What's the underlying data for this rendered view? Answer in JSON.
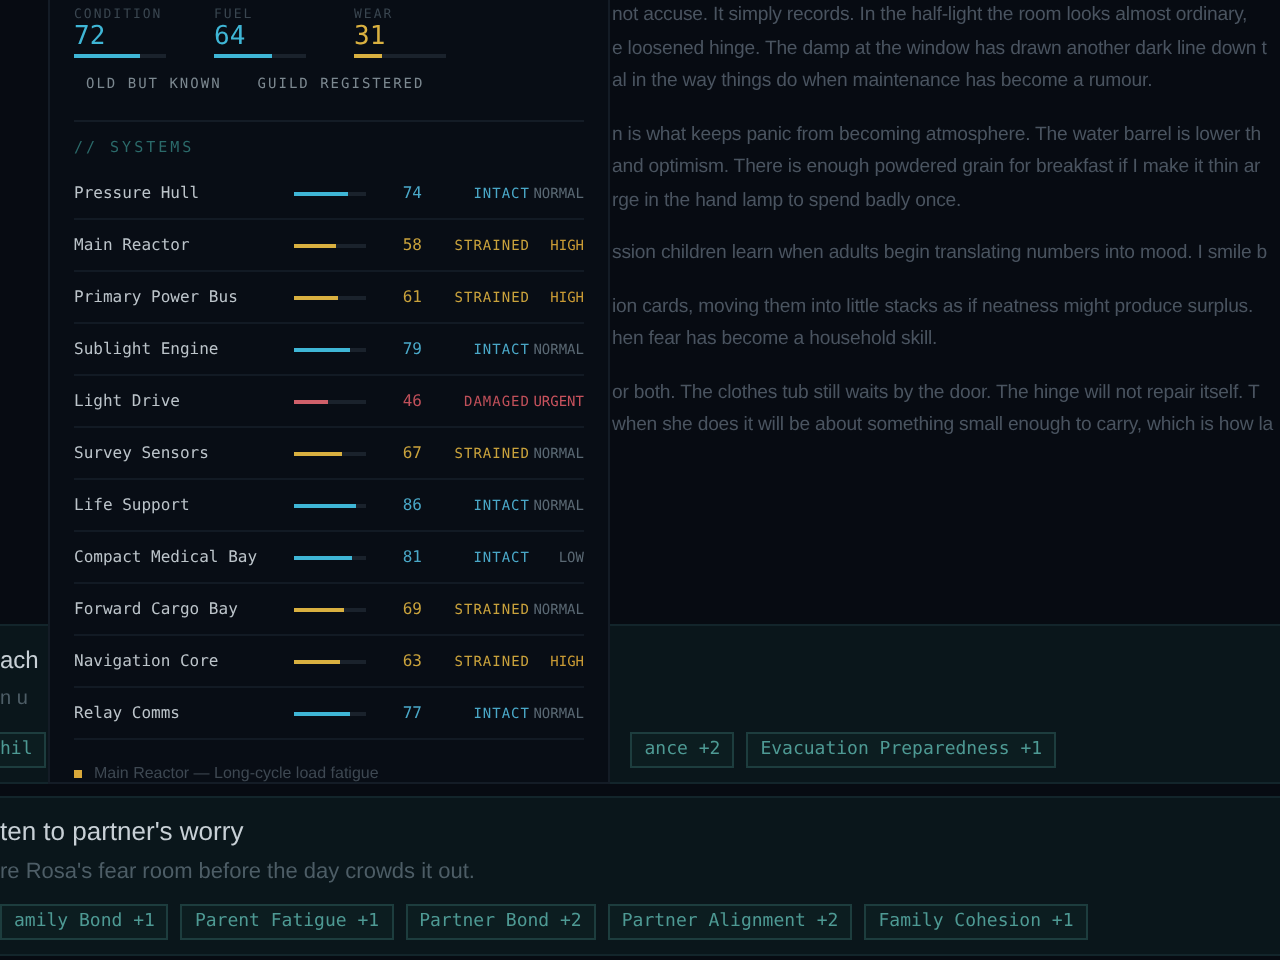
{
  "journal": {
    "paragraphs": [
      {
        "lines": [
          "not accuse. It simply records. In the half-light the room looks almost ordinary,",
          "e loosened hinge. The damp at the window has drawn another dark line down t",
          "al in the way things do when maintenance has become a rumour."
        ]
      },
      {
        "lines": [
          "n is what keeps panic from becoming atmosphere. The water barrel is lower th",
          "and optimism. There is enough powdered grain for breakfast if I make it thin ar",
          "rge in the hand lamp to spend badly once."
        ]
      },
      {
        "lines": [
          "ssion children learn when adults begin translating numbers into mood. I smile b"
        ]
      },
      {
        "lines": [
          "ion cards, moving them into little stacks as if neatness might produce surplus.",
          "hen fear has become a household skill."
        ]
      },
      {
        "lines": [
          "or both. The clothes tub still waits by the door. The hinge will not repair itself. T",
          "when she does it will be about something small enough to carry, which is how la"
        ]
      }
    ]
  },
  "actions": [
    {
      "title": "ach",
      "subtitle": "n u",
      "effects": [
        "hil",
        "ance +2",
        "Evacuation Preparedness +1"
      ]
    },
    {
      "title": "ten to partner's worry",
      "subtitle": "re Rosa's fear room before the day crowds it out.",
      "effects": [
        "amily Bond +1",
        "Parent Fatigue +1",
        "Partner Bond +2",
        "Partner Alignment +2",
        "Family Cohesion +1"
      ]
    }
  ],
  "ship_panel": {
    "stats": [
      {
        "label": "CONDITION",
        "value": "72",
        "level": 0.72,
        "kind": "good"
      },
      {
        "label": "FUEL",
        "value": "64",
        "level": 0.64,
        "kind": "good"
      },
      {
        "label": "WEAR",
        "value": "31",
        "level": 0.31,
        "kind": "warn"
      }
    ],
    "tags": [
      "OLD BUT KNOWN",
      "GUILD REGISTERED"
    ],
    "section_title": "// SYSTEMS",
    "systems": [
      {
        "name": "Pressure Hull",
        "value": "74",
        "level": 0.74,
        "kind": "intact",
        "status": "INTACT",
        "priority": {
          "label": "NORMAL",
          "color": "#5a6873"
        }
      },
      {
        "name": "Main Reactor",
        "value": "58",
        "level": 0.58,
        "kind": "strained",
        "status": "STRAINED",
        "priority": {
          "label": "HIGH",
          "color": "#c99a34"
        }
      },
      {
        "name": "Primary Power Bus",
        "value": "61",
        "level": 0.61,
        "kind": "strained",
        "status": "STRAINED",
        "priority": {
          "label": "HIGH",
          "color": "#c99a34"
        }
      },
      {
        "name": "Sublight Engine",
        "value": "79",
        "level": 0.79,
        "kind": "intact",
        "status": "INTACT",
        "priority": {
          "label": "NORMAL",
          "color": "#5a6873"
        }
      },
      {
        "name": "Light Drive",
        "value": "46",
        "level": 0.46,
        "kind": "damaged",
        "status": "DAMAGED",
        "priority": {
          "label": "URGENT",
          "color": "#c8525d"
        }
      },
      {
        "name": "Survey Sensors",
        "value": "67",
        "level": 0.67,
        "kind": "strained",
        "status": "STRAINED",
        "priority": {
          "label": "NORMAL",
          "color": "#5a6873"
        }
      },
      {
        "name": "Life Support",
        "value": "86",
        "level": 0.86,
        "kind": "intact",
        "status": "INTACT",
        "priority": {
          "label": "NORMAL",
          "color": "#5a6873"
        }
      },
      {
        "name": "Compact Medical Bay",
        "value": "81",
        "level": 0.81,
        "kind": "intact",
        "status": "INTACT",
        "priority": {
          "label": "LOW",
          "color": "#5a6873"
        }
      },
      {
        "name": "Forward Cargo Bay",
        "value": "69",
        "level": 0.69,
        "kind": "strained",
        "status": "STRAINED",
        "priority": {
          "label": "NORMAL",
          "color": "#5a6873"
        }
      },
      {
        "name": "Navigation Core",
        "value": "63",
        "level": 0.63,
        "kind": "strained",
        "status": "STRAINED",
        "priority": {
          "label": "HIGH",
          "color": "#c99a34"
        }
      },
      {
        "name": "Relay Comms",
        "value": "77",
        "level": 0.77,
        "kind": "intact",
        "status": "INTACT",
        "priority": {
          "label": "NORMAL",
          "color": "#5a6873"
        }
      }
    ],
    "notes": [
      {
        "text": "Main Reactor — Long-cycle load fatigue",
        "color": "#d9a83a"
      }
    ]
  }
}
